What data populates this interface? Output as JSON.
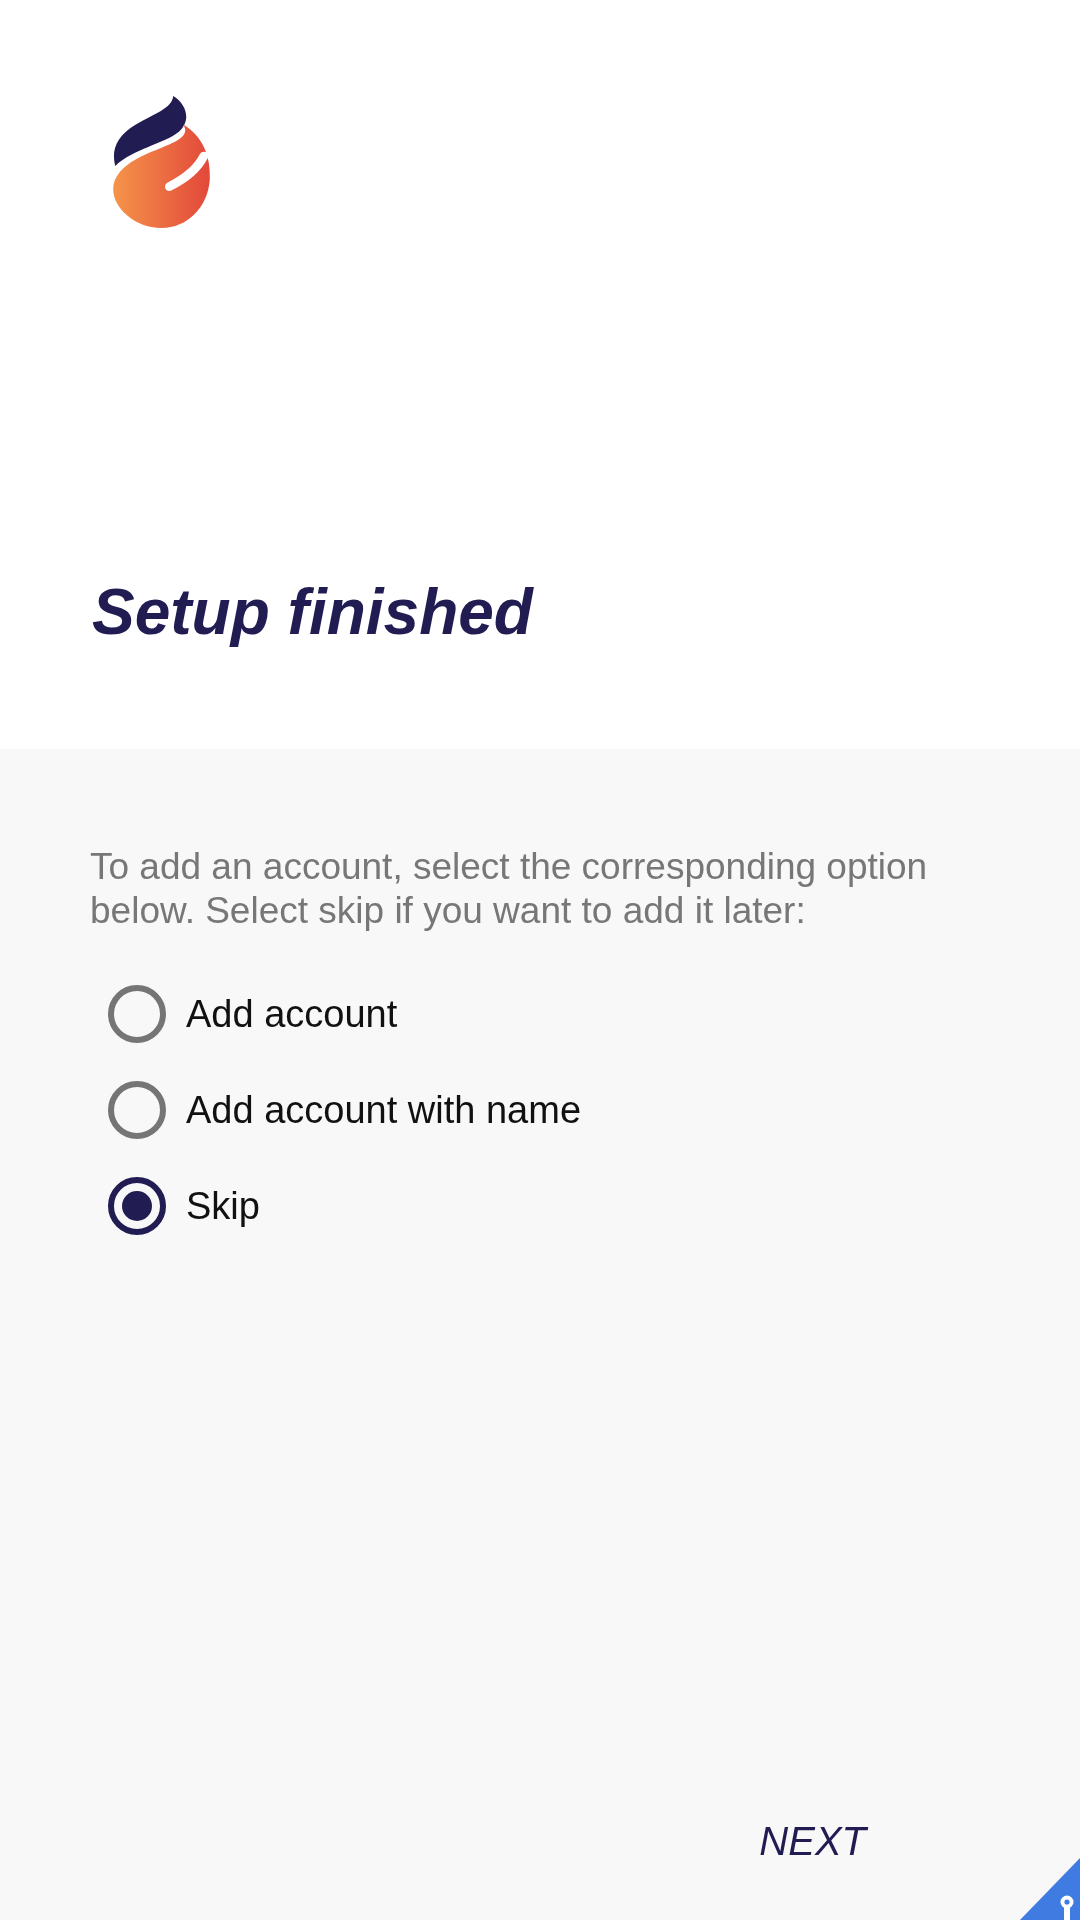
{
  "title": "Setup finished",
  "instructions": "To add an account, select the corresponding option below. Select skip if you want to add it later:",
  "options": [
    {
      "label": "Add account",
      "selected": false
    },
    {
      "label": "Add account with name",
      "selected": false
    },
    {
      "label": "Skip",
      "selected": true
    }
  ],
  "next_button": {
    "label": "NEXT"
  }
}
